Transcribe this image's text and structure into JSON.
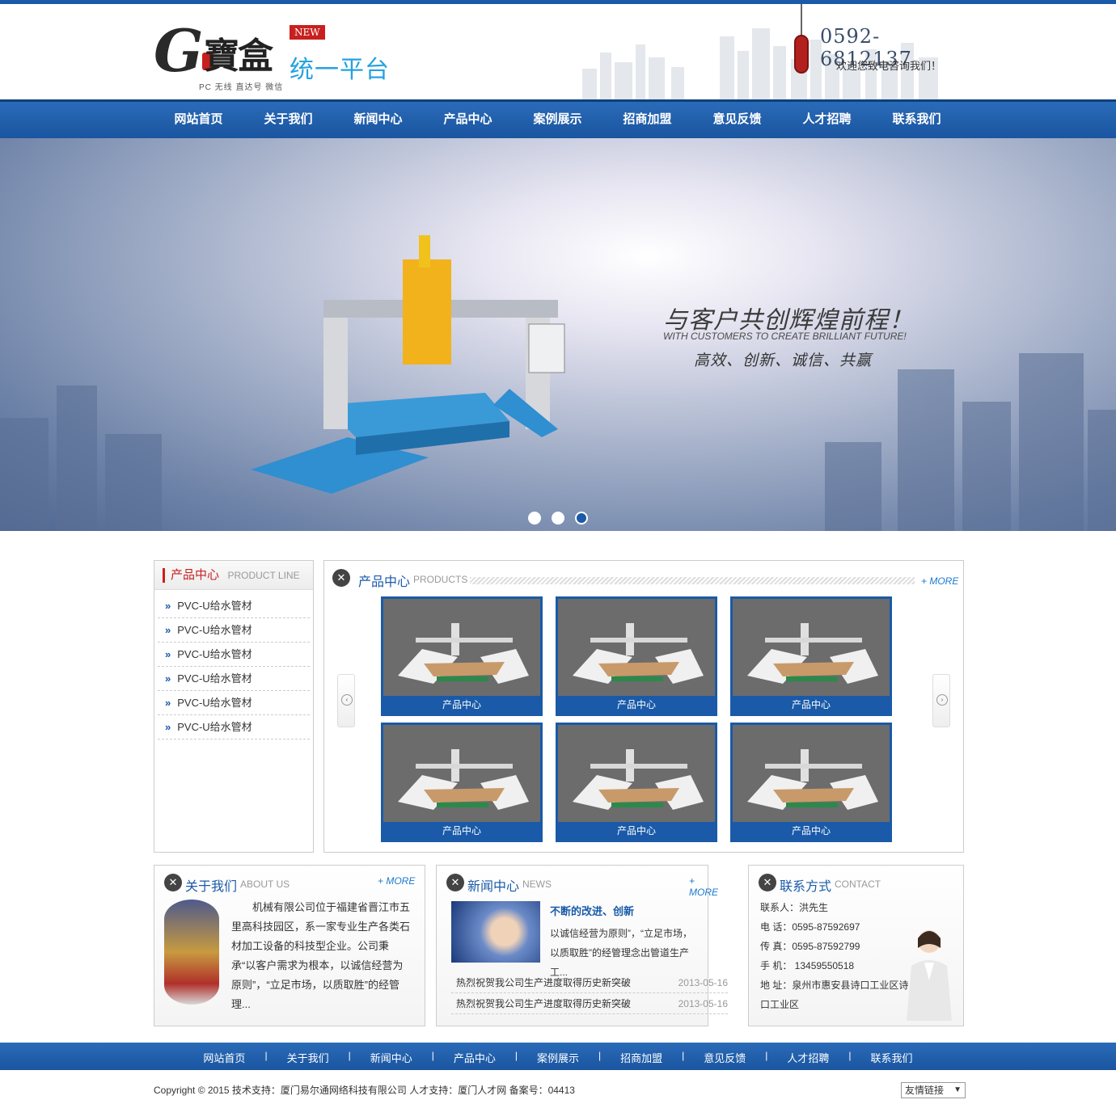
{
  "header": {
    "logo_letter": "G",
    "logo_brand": "寶盒",
    "logo_new": "NEW",
    "logo_platform": "统一平台",
    "logo_sub": "PC 无线 直达号 微信",
    "phone": "0592-6812137",
    "phone_tip": "欢迎您致电咨询我们！"
  },
  "nav": [
    "网站首页",
    "关于我们",
    "新闻中心",
    "产品中心",
    "案例展示",
    "招商加盟",
    "意见反馈",
    "人才招聘",
    "联系我们"
  ],
  "banner": {
    "title": "与客户共创辉煌前程！",
    "subtitle_en": "WITH CUSTOMERS TO CREATE BRILLIANT FUTURE!",
    "slogan": "高效、创新、诚信、共赢",
    "slides": 3,
    "active_slide": 3
  },
  "sidebar": {
    "title": "产品中心",
    "title_en": "PRODUCT LINE",
    "items": [
      "PVC-U给水管材",
      "PVC-U给水管材",
      "PVC-U给水管材",
      "PVC-U给水管材",
      "PVC-U给水管材",
      "PVC-U给水管材"
    ]
  },
  "products": {
    "title": "产品中心",
    "title_en": "PRODUCTS",
    "more": "+ MORE",
    "items": [
      "产品中心",
      "产品中心",
      "产品中心",
      "产品中心",
      "产品中心",
      "产品中心"
    ]
  },
  "about": {
    "title": "关于我们",
    "title_en": "ABOUT US",
    "more": "+ MORE",
    "text": "机械有限公司位于福建省晋江市五里高科技园区，系一家专业生产各类石材加工设备的科技型企业。公司秉承“以客户需求为根本，以诚信经营为原则”，“立足市场，以质取胜”的经管理..."
  },
  "news": {
    "title": "新闻中心",
    "title_en": "NEWS",
    "more": "+ MORE",
    "featured_title": "不断的改进、创新",
    "featured_desc": "以诚信经营为原则”，“立足市场，以质取胜”的经管理念出管道生产工...",
    "items": [
      {
        "title": "热烈祝贺我公司生产进度取得历史新突破",
        "date": "2013-05-16"
      },
      {
        "title": "热烈祝贺我公司生产进度取得历史新突破",
        "date": "2013-05-16"
      }
    ]
  },
  "contact": {
    "title": "联系方式",
    "title_en": "CONTACT",
    "person": "联系人：洪先生",
    "tel": "电  话：0595-87592697",
    "fax": "传  真：0595-87592799",
    "mobile": "手  机： 13459550518",
    "address": "地  址：泉州市惠安县诗口工业区诗口工业区"
  },
  "footer": {
    "nav": [
      "网站首页",
      "关于我们",
      "新闻中心",
      "产品中心",
      "案例展示",
      "招商加盟",
      "意见反馈",
      "人才招聘",
      "联系我们"
    ],
    "copyright": "Copyright © 2015    技术支持：厦门易尔通网络科技有限公司 人才支持：厦门人才网 备案号：04413",
    "links_label": "友情链接"
  },
  "colors": {
    "primary": "#1a5aa8",
    "accent_red": "#c8201e",
    "platform_blue": "#26a2e0"
  }
}
